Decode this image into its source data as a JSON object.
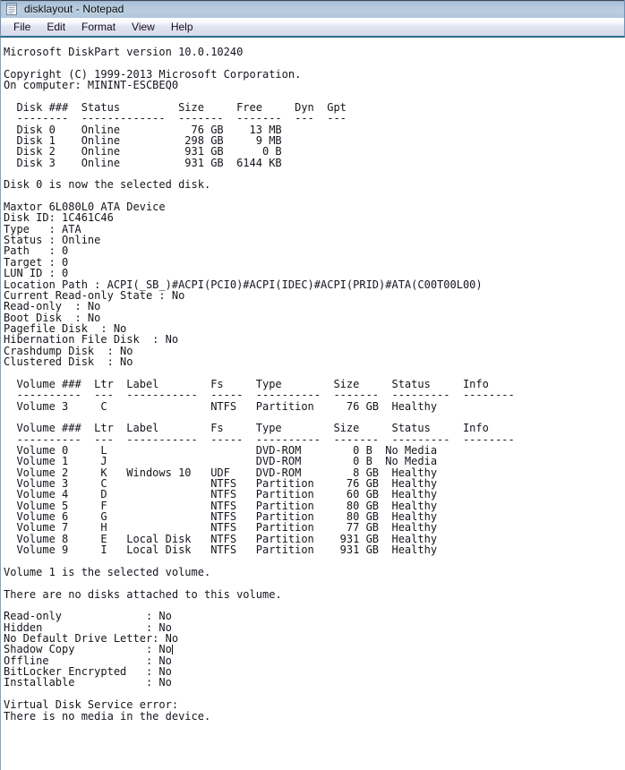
{
  "window": {
    "title": "disklayout - Notepad",
    "icon": "notepad-icon",
    "accent_titlebar": "#b3c7dc",
    "accent_menubar": "#d9dcec",
    "accent_border": "#2a6b8a",
    "text_color": "#16141c",
    "background": "#ffffff"
  },
  "menu": {
    "items": [
      {
        "label": "File"
      },
      {
        "label": "Edit"
      },
      {
        "label": "Format"
      },
      {
        "label": "View"
      },
      {
        "label": "Help"
      }
    ]
  },
  "document": {
    "filename": "disklayout",
    "caret_line_index": 54,
    "header": {
      "product_line": "Microsoft DiskPart version 10.0.10240",
      "copyright": "Copyright (C) 1999-2013 Microsoft Corporation.",
      "computer": "On computer: MININT-ESCBEQ0"
    },
    "disk_table": {
      "columns": [
        "Disk ###",
        "Status",
        "Size",
        "Free",
        "Dyn",
        "Gpt"
      ],
      "rules": [
        "--------",
        "-------------",
        "-------",
        "-------",
        "---",
        "---"
      ],
      "rows": [
        {
          "disk": "Disk 0",
          "status": "Online",
          "size": "76 GB",
          "free": "13 MB",
          "dyn": "",
          "gpt": ""
        },
        {
          "disk": "Disk 1",
          "status": "Online",
          "size": "298 GB",
          "free": "9 MB",
          "dyn": "",
          "gpt": ""
        },
        {
          "disk": "Disk 2",
          "status": "Online",
          "size": "931 GB",
          "free": "0 B",
          "dyn": "",
          "gpt": ""
        },
        {
          "disk": "Disk 3",
          "status": "Online",
          "size": "931 GB",
          "free": "6144 KB",
          "dyn": "",
          "gpt": ""
        }
      ]
    },
    "selected_disk_message": "Disk 0 is now the selected disk.",
    "disk_detail": {
      "model": "Maxtor 6L080L0 ATA Device",
      "fields": [
        {
          "label": "Disk ID",
          "value": "1C461C46",
          "rendered": "Disk ID: 1C461C46"
        },
        {
          "label": "Type",
          "value": "ATA",
          "rendered": "Type   : ATA"
        },
        {
          "label": "Status",
          "value": "Online",
          "rendered": "Status : Online"
        },
        {
          "label": "Path",
          "value": "0",
          "rendered": "Path   : 0"
        },
        {
          "label": "Target",
          "value": "0",
          "rendered": "Target : 0"
        },
        {
          "label": "LUN ID",
          "value": "0",
          "rendered": "LUN ID : 0"
        },
        {
          "label": "Location Path",
          "value": "ACPI(_SB_)#ACPI(PCI0)#ACPI(IDEC)#ACPI(PRID)#ATA(C00T00L00)",
          "rendered": "Location Path : ACPI(_SB_)#ACPI(PCI0)#ACPI(IDEC)#ACPI(PRID)#ATA(C00T00L00)"
        },
        {
          "label": "Current Read-only State",
          "value": "No",
          "rendered": "Current Read-only State : No"
        },
        {
          "label": "Read-only",
          "value": "No",
          "rendered": "Read-only  : No"
        },
        {
          "label": "Boot Disk",
          "value": "No",
          "rendered": "Boot Disk  : No"
        },
        {
          "label": "Pagefile Disk",
          "value": "No",
          "rendered": "Pagefile Disk  : No"
        },
        {
          "label": "Hibernation File Disk",
          "value": "No",
          "rendered": "Hibernation File Disk  : No"
        },
        {
          "label": "Crashdump Disk",
          "value": "No",
          "rendered": "Crashdump Disk  : No"
        },
        {
          "label": "Clustered Disk",
          "value": "No",
          "rendered": "Clustered Disk  : No"
        }
      ]
    },
    "volume_table_1": {
      "columns": [
        "Volume ###",
        "Ltr",
        "Label",
        "Fs",
        "Type",
        "Size",
        "Status",
        "Info"
      ],
      "rules": [
        "----------",
        "---",
        "-----------",
        "-----",
        "----------",
        "-------",
        "---------",
        "--------"
      ],
      "rows": [
        {
          "volume": "Volume 3",
          "ltr": "C",
          "label": "",
          "fs": "NTFS",
          "type": "Partition",
          "size": "76 GB",
          "status": "Healthy",
          "info": ""
        }
      ]
    },
    "volume_table_2": {
      "columns": [
        "Volume ###",
        "Ltr",
        "Label",
        "Fs",
        "Type",
        "Size",
        "Status",
        "Info"
      ],
      "rules": [
        "----------",
        "---",
        "-----------",
        "-----",
        "----------",
        "-------",
        "---------",
        "--------"
      ],
      "rows": [
        {
          "volume": "Volume 0",
          "ltr": "L",
          "label": "",
          "fs": "",
          "type": "DVD-ROM",
          "size": "0 B",
          "status": "No Media",
          "info": ""
        },
        {
          "volume": "Volume 1",
          "ltr": "J",
          "label": "",
          "fs": "",
          "type": "DVD-ROM",
          "size": "0 B",
          "status": "No Media",
          "info": ""
        },
        {
          "volume": "Volume 2",
          "ltr": "K",
          "label": "Windows 10",
          "fs": "UDF",
          "type": "DVD-ROM",
          "size": "8 GB",
          "status": "Healthy",
          "info": ""
        },
        {
          "volume": "Volume 3",
          "ltr": "C",
          "label": "",
          "fs": "NTFS",
          "type": "Partition",
          "size": "76 GB",
          "status": "Healthy",
          "info": ""
        },
        {
          "volume": "Volume 4",
          "ltr": "D",
          "label": "",
          "fs": "NTFS",
          "type": "Partition",
          "size": "60 GB",
          "status": "Healthy",
          "info": ""
        },
        {
          "volume": "Volume 5",
          "ltr": "F",
          "label": "",
          "fs": "NTFS",
          "type": "Partition",
          "size": "80 GB",
          "status": "Healthy",
          "info": ""
        },
        {
          "volume": "Volume 6",
          "ltr": "G",
          "label": "",
          "fs": "NTFS",
          "type": "Partition",
          "size": "80 GB",
          "status": "Healthy",
          "info": ""
        },
        {
          "volume": "Volume 7",
          "ltr": "H",
          "label": "",
          "fs": "NTFS",
          "type": "Partition",
          "size": "77 GB",
          "status": "Healthy",
          "info": ""
        },
        {
          "volume": "Volume 8",
          "ltr": "E",
          "label": "Local Disk",
          "fs": "NTFS",
          "type": "Partition",
          "size": "931 GB",
          "status": "Healthy",
          "info": ""
        },
        {
          "volume": "Volume 9",
          "ltr": "I",
          "label": "Local Disk",
          "fs": "NTFS",
          "type": "Partition",
          "size": "931 GB",
          "status": "Healthy",
          "info": ""
        }
      ]
    },
    "selected_volume_message": "Volume 1 is the selected volume.",
    "no_disks_message": "There are no disks attached to this volume.",
    "volume_attributes": [
      {
        "label": "Read-only",
        "value": "No",
        "rendered": "Read-only             : No"
      },
      {
        "label": "Hidden",
        "value": "No",
        "rendered": "Hidden                : No"
      },
      {
        "label": "No Default Drive Letter",
        "value": "No",
        "rendered": "No Default Drive Letter: No"
      },
      {
        "label": "Shadow Copy",
        "value": "No",
        "rendered": "Shadow Copy           : No"
      },
      {
        "label": "Offline",
        "value": "No",
        "rendered": "Offline               : No"
      },
      {
        "label": "BitLocker Encrypted",
        "value": "No",
        "rendered": "BitLocker Encrypted   : No"
      },
      {
        "label": "Installable",
        "value": "No",
        "rendered": "Installable           : No"
      }
    ],
    "error": {
      "title": "Virtual Disk Service error:",
      "detail": "There is no media in the device."
    },
    "lines": [
      "Microsoft DiskPart version 10.0.10240",
      "",
      "Copyright (C) 1999-2013 Microsoft Corporation.",
      "On computer: MININT-ESCBEQ0",
      "",
      "  Disk ###  Status         Size     Free     Dyn  Gpt",
      "  --------  -------------  -------  -------  ---  ---",
      "  Disk 0    Online           76 GB    13 MB",
      "  Disk 1    Online          298 GB     9 MB",
      "  Disk 2    Online          931 GB      0 B",
      "  Disk 3    Online          931 GB  6144 KB",
      "",
      "Disk 0 is now the selected disk.",
      "",
      "Maxtor 6L080L0 ATA Device",
      "Disk ID: 1C461C46",
      "Type   : ATA",
      "Status : Online",
      "Path   : 0",
      "Target : 0",
      "LUN ID : 0",
      "Location Path : ACPI(_SB_)#ACPI(PCI0)#ACPI(IDEC)#ACPI(PRID)#ATA(C00T00L00)",
      "Current Read-only State : No",
      "Read-only  : No",
      "Boot Disk  : No",
      "Pagefile Disk  : No",
      "Hibernation File Disk  : No",
      "Crashdump Disk  : No",
      "Clustered Disk  : No",
      "",
      "  Volume ###  Ltr  Label        Fs     Type        Size     Status     Info",
      "  ----------  ---  -----------  -----  ----------  -------  ---------  --------",
      "  Volume 3     C                NTFS   Partition     76 GB  Healthy",
      "",
      "  Volume ###  Ltr  Label        Fs     Type        Size     Status     Info",
      "  ----------  ---  -----------  -----  ----------  -------  ---------  --------",
      "  Volume 0     L                       DVD-ROM        0 B  No Media",
      "  Volume 1     J                       DVD-ROM        0 B  No Media",
      "  Volume 2     K   Windows 10   UDF    DVD-ROM        8 GB  Healthy",
      "  Volume 3     C                NTFS   Partition     76 GB  Healthy",
      "  Volume 4     D                NTFS   Partition     60 GB  Healthy",
      "  Volume 5     F                NTFS   Partition     80 GB  Healthy",
      "  Volume 6     G                NTFS   Partition     80 GB  Healthy",
      "  Volume 7     H                NTFS   Partition     77 GB  Healthy",
      "  Volume 8     E   Local Disk   NTFS   Partition    931 GB  Healthy",
      "  Volume 9     I   Local Disk   NTFS   Partition    931 GB  Healthy",
      "",
      "Volume 1 is the selected volume.",
      "",
      "There are no disks attached to this volume.",
      "",
      "Read-only             : No",
      "Hidden                : No",
      "No Default Drive Letter: No",
      "Shadow Copy           : No",
      "Offline               : No",
      "BitLocker Encrypted   : No",
      "Installable           : No",
      "",
      "Virtual Disk Service error:",
      "There is no media in the device."
    ]
  }
}
